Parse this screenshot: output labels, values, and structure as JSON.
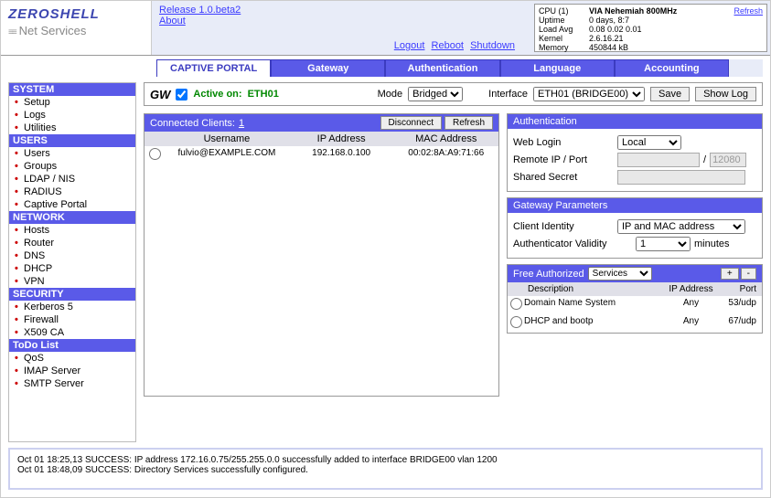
{
  "logo": {
    "title": "ZEROSHELL",
    "sub": "Net Services"
  },
  "release": {
    "version": "Release 1.0.beta2",
    "about": "About"
  },
  "header_links": {
    "logout": "Logout",
    "reboot": "Reboot",
    "shutdown": "Shutdown"
  },
  "stats": {
    "cpu_k": "CPU (1)",
    "cpu_v": "VIA Nehemiah 800MHz",
    "uptime_k": "Uptime",
    "uptime_v": "0 days, 8:7",
    "load_k": "Load Avg",
    "load_v": "0.08 0.02 0.01",
    "kernel_k": "Kernel",
    "kernel_v": "2.6.16.21",
    "mem_k": "Memory",
    "mem_v": "450844 kB",
    "refresh": "Refresh"
  },
  "tabs": {
    "captive": "CAPTIVE PORTAL",
    "gateway": "Gateway",
    "auth": "Authentication",
    "lang": "Language",
    "acct": "Accounting"
  },
  "sidebar": {
    "system": {
      "head": "SYSTEM",
      "setup": "Setup",
      "logs": "Logs",
      "utilities": "Utilities"
    },
    "users": {
      "head": "USERS",
      "users": "Users",
      "groups": "Groups",
      "ldap": "LDAP / NIS",
      "radius": "RADIUS",
      "captive": "Captive Portal"
    },
    "network": {
      "head": "NETWORK",
      "hosts": "Hosts",
      "router": "Router",
      "dns": "DNS",
      "dhcp": "DHCP",
      "vpn": "VPN"
    },
    "security": {
      "head": "SECURITY",
      "krb": "Kerberos 5",
      "fw": "Firewall",
      "x509": "X509 CA"
    },
    "todo": {
      "head": "ToDo List",
      "qos": "QoS",
      "imap": "IMAP Server",
      "smtp": "SMTP Server"
    }
  },
  "gw": {
    "label": "GW",
    "active": "Active on:",
    "iface_active": "ETH01",
    "mode_label": "Mode",
    "mode_value": "Bridged",
    "iface_label": "Interface",
    "iface_value": "ETH01 (BRIDGE00)",
    "save": "Save",
    "showlog": "Show Log"
  },
  "clients": {
    "title": "Connected Clients:",
    "count": "1",
    "disconnect": "Disconnect",
    "refresh": "Refresh",
    "col_user": "Username",
    "col_ip": "IP Address",
    "col_mac": "MAC Address",
    "rows": [
      {
        "user": "fulvio@EXAMPLE.COM",
        "ip": "192.168.0.100",
        "mac": "00:02:8A:A9:71:66"
      }
    ]
  },
  "auth_box": {
    "title": "Authentication",
    "web_login_k": "Web Login",
    "web_login_v": "Local",
    "remote_k": "Remote IP / Port",
    "remote_ip": "",
    "remote_port": "12080",
    "secret_k": "Shared Secret",
    "secret_v": ""
  },
  "gwparams": {
    "title": "Gateway Parameters",
    "client_id_k": "Client Identity",
    "client_id_v": "IP and MAC address",
    "auth_val_k": "Authenticator Validity",
    "auth_val_v": "1",
    "minutes": "minutes"
  },
  "free": {
    "title": "Free Authorized",
    "select": "Services",
    "plus": "+",
    "minus": "-",
    "col_desc": "Description",
    "col_ip": "IP Address",
    "col_port": "Port",
    "rows": [
      {
        "desc": "Domain Name System",
        "ip": "Any",
        "port": "53/udp"
      },
      {
        "desc": "DHCP and bootp",
        "ip": "Any",
        "port": "67/udp"
      }
    ]
  },
  "log": {
    "l1": "Oct 01 18:25,13 SUCCESS: IP address 172.16.0.75/255.255.0.0 successfully added to interface BRIDGE00 vlan 1200",
    "l2": "Oct 01 18:48,09 SUCCESS: Directory Services successfully configured."
  }
}
